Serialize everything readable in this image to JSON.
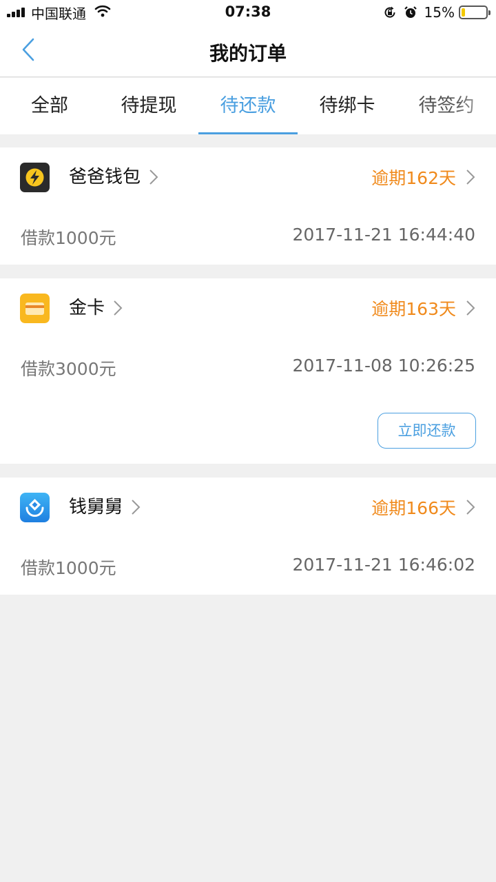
{
  "status_bar": {
    "carrier": "中国联通",
    "time": "07:38",
    "battery_percent": "15%",
    "battery_level": 0.15,
    "icons": [
      "signal-icon",
      "wifi-icon",
      "orientation-lock-icon",
      "alarm-icon",
      "battery-icon"
    ]
  },
  "nav": {
    "back_icon": "chevron-left-icon",
    "title": "我的订单"
  },
  "tabs": [
    {
      "label": "全部"
    },
    {
      "label": "待提现"
    },
    {
      "label": "待还款"
    },
    {
      "label": "待绑卡"
    },
    {
      "label": "待签约"
    }
  ],
  "active_tab": 2,
  "colors": {
    "accent": "#4a9fe0",
    "overdue": "#f08a1c",
    "background": "#f0f0f0"
  },
  "orders": [
    {
      "merchant": "爸爸钱包",
      "logo_icon": "baba-wallet-logo-icon",
      "overdue": "逾期162天",
      "amount": "借款1000元",
      "time": "2017-11-21 16:44:40"
    },
    {
      "merchant": "金卡",
      "logo_icon": "gold-card-logo-icon",
      "overdue": "逾期163天",
      "amount": "借款3000元",
      "time": "2017-11-08 10:26:25",
      "action": "立即还款"
    },
    {
      "merchant": "钱舅舅",
      "logo_icon": "qian-jiujiu-logo-icon",
      "overdue": "逾期166天",
      "amount": "借款1000元",
      "time": "2017-11-21 16:46:02"
    }
  ]
}
